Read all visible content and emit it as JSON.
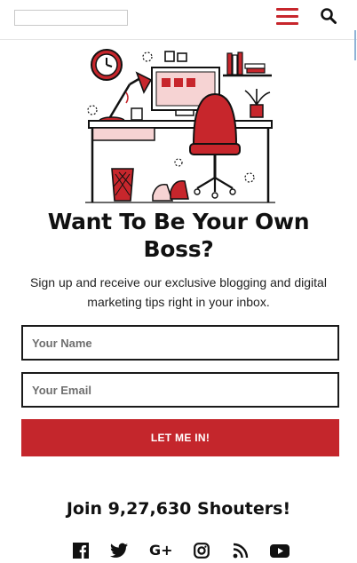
{
  "header": {
    "menu_icon": "hamburger-menu-icon",
    "search_icon": "search-icon",
    "accent_color": "#c7262c"
  },
  "hero": {
    "illustration": "home-office-desk-illustration",
    "headline": "Want To Be Your Own Boss?",
    "subtext": "Sign up and receive our exclusive blogging and digital marketing tips right in your inbox."
  },
  "form": {
    "name_placeholder": "Your Name",
    "email_placeholder": "Your Email",
    "submit_label": "LET ME IN!",
    "button_color": "#c4262c"
  },
  "community": {
    "join_text": "Join 9,27,630 Shouters!",
    "social_icons": [
      "facebook-icon",
      "twitter-icon",
      "google-plus-icon",
      "instagram-icon",
      "rss-icon",
      "youtube-icon"
    ],
    "google_plus_glyph": "G+"
  }
}
